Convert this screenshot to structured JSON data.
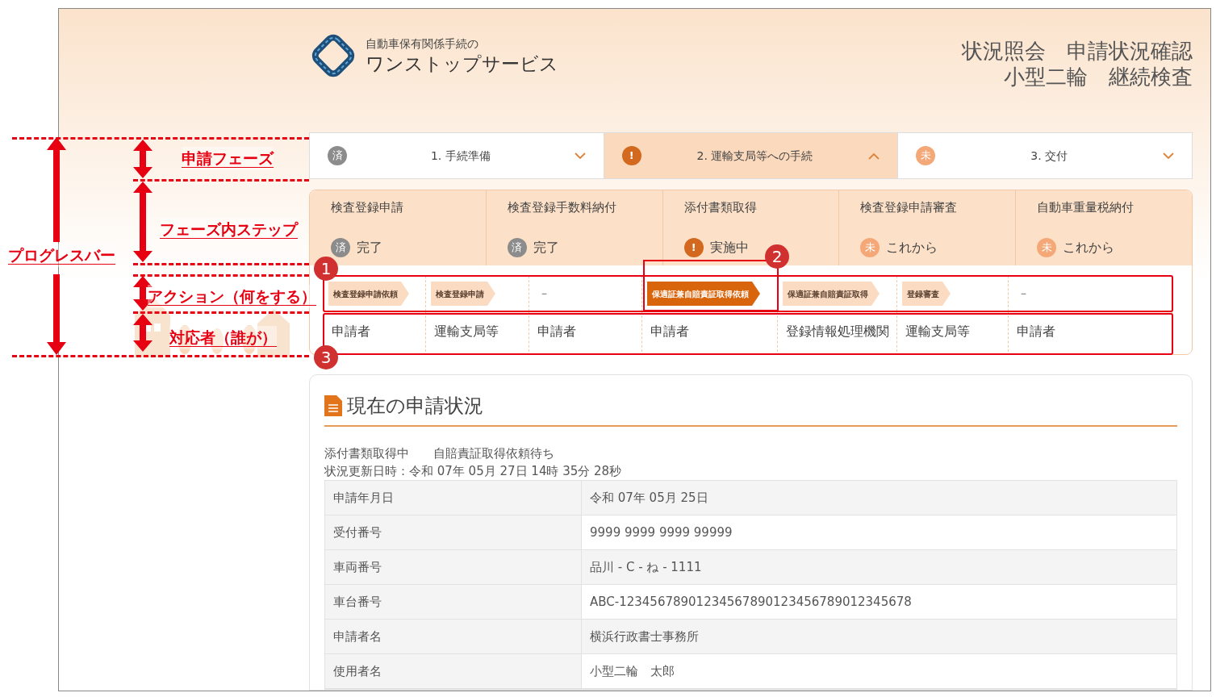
{
  "annotations": {
    "labels": [
      {
        "kind": "progress",
        "text": "プログレスバー"
      },
      {
        "kind": "phase",
        "text": "申請フェーズ"
      },
      {
        "kind": "step",
        "text": "フェーズ内ステップ"
      },
      {
        "kind": "action",
        "text": "アクション（何をする）"
      },
      {
        "kind": "actor",
        "text": "対応者（誰が）"
      }
    ],
    "markers": [
      "1",
      "2",
      "3"
    ]
  },
  "header": {
    "logo_subtitle": "自動車保有関係手続の",
    "logo_title": "ワンストップサービス",
    "title_lines": [
      "状況照会　申請状況確認",
      "小型二輪　継続検査"
    ]
  },
  "phases": [
    {
      "kind": "done",
      "badge": "済",
      "label": "1. 手続準備",
      "selected": false,
      "expanded": false
    },
    {
      "kind": "active",
      "badge": "!",
      "label": "2. 運輸支局等への手続",
      "selected": true,
      "expanded": true
    },
    {
      "kind": "todo",
      "badge": "未",
      "label": "3. 交付",
      "selected": false,
      "expanded": false
    }
  ],
  "steps": [
    {
      "title": "検査登録申請",
      "kind": "done",
      "badge": "済",
      "state_text": "完了"
    },
    {
      "title": "検査登録手数料納付",
      "kind": "done",
      "badge": "済",
      "state_text": "完了"
    },
    {
      "title": "添付書類取得",
      "kind": "active",
      "badge": "!",
      "state_text": "実施中"
    },
    {
      "title": "検査登録申請審査",
      "kind": "todo",
      "badge": "未",
      "state_text": "これから"
    },
    {
      "title": "自動車重量税納付",
      "kind": "todo",
      "badge": "未",
      "state_text": "これから"
    }
  ],
  "actions": [
    {
      "kind": "tag",
      "label": "検査登録申請依頼",
      "selected": false
    },
    {
      "kind": "tag",
      "label": "検査登録申請",
      "selected": false
    },
    {
      "kind": "dash",
      "label": "－",
      "selected": false
    },
    {
      "kind": "tag",
      "label": "保適証兼自賠責証取得依頼",
      "selected": true
    },
    {
      "kind": "tag",
      "label": "保適証兼自賠責証取得",
      "selected": false
    },
    {
      "kind": "tag",
      "label": "登録審査",
      "selected": false
    },
    {
      "kind": "dash",
      "label": "－",
      "selected": false
    }
  ],
  "actors": [
    "申請者",
    "運輸支局等",
    "申請者",
    "申請者",
    "登録情報処理機関",
    "運輸支局等",
    "申請者"
  ],
  "status_card": {
    "title": "現在の申請状況",
    "status_line": "添付書類取得中　　自賠責証取得依頼待ち",
    "updated": "状況更新日時：令和 07年 05月 27日 14時 35分 28秒",
    "rows": [
      {
        "label": "申請年月日",
        "value": "令和 07年 05月 25日"
      },
      {
        "label": "受付番号",
        "value": "9999 9999 9999 99999"
      },
      {
        "label": "車両番号",
        "value": "品川 - C - ね - 1111"
      },
      {
        "label": "車台番号",
        "value": "ABC-12345678901234567890123456789012345678"
      },
      {
        "label": "申請者名",
        "value": "横浜行政書士事務所"
      },
      {
        "label": "使用者名",
        "value": "小型二輪　太郎"
      }
    ]
  }
}
